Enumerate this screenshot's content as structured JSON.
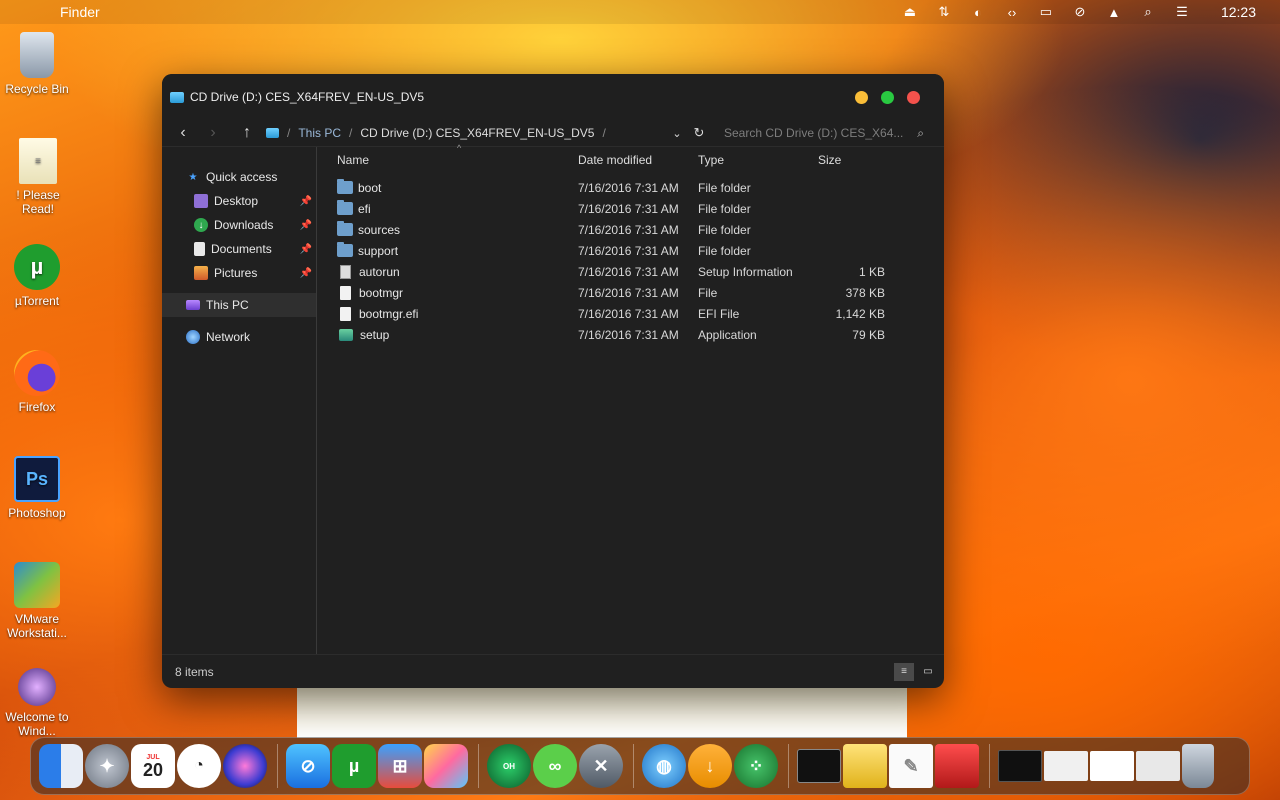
{
  "menubar": {
    "app_name": "Finder",
    "clock": "12:23",
    "status_icons": [
      "eject-icon",
      "switch-icon",
      "night-mode-icon",
      "code-icon",
      "display-icon",
      "mute-icon",
      "eject-up-icon",
      "search-icon",
      "control-center-icon"
    ]
  },
  "desktop": {
    "icons": [
      {
        "label": "Recycle Bin",
        "icon": "recycle-bin-icon"
      },
      {
        "label": "! Please Read!",
        "icon": "notepad-icon"
      },
      {
        "label": "µTorrent",
        "icon": "utorrent-icon"
      },
      {
        "label": "Firefox",
        "icon": "firefox-icon"
      },
      {
        "label": "Photoshop",
        "icon": "photoshop-icon",
        "glyph": "Ps"
      },
      {
        "label": "VMware Workstati...",
        "icon": "vmware-icon"
      },
      {
        "label": "Welcome to Wind...",
        "icon": "welcome-icon"
      }
    ]
  },
  "window": {
    "title": "CD Drive (D:) CES_X64FREV_EN-US_DV5",
    "breadcrumb": [
      "This PC",
      "CD Drive (D:) CES_X64FREV_EN-US_DV5"
    ],
    "search_placeholder": "Search CD Drive (D:) CES_X64...",
    "sidebar": {
      "quick_access": "Quick access",
      "items": [
        {
          "label": "Desktop",
          "pinned": true
        },
        {
          "label": "Downloads",
          "pinned": true
        },
        {
          "label": "Documents",
          "pinned": true
        },
        {
          "label": "Pictures",
          "pinned": true
        }
      ],
      "this_pc": "This PC",
      "network": "Network"
    },
    "columns": {
      "name": "Name",
      "date": "Date modified",
      "type": "Type",
      "size": "Size"
    },
    "files": [
      {
        "name": "boot",
        "date": "7/16/2016 7:31 AM",
        "type": "File folder",
        "size": "",
        "kind": "folder"
      },
      {
        "name": "efi",
        "date": "7/16/2016 7:31 AM",
        "type": "File folder",
        "size": "",
        "kind": "folder"
      },
      {
        "name": "sources",
        "date": "7/16/2016 7:31 AM",
        "type": "File folder",
        "size": "",
        "kind": "folder"
      },
      {
        "name": "support",
        "date": "7/16/2016 7:31 AM",
        "type": "File folder",
        "size": "",
        "kind": "folder"
      },
      {
        "name": "autorun",
        "date": "7/16/2016 7:31 AM",
        "type": "Setup Information",
        "size": "1 KB",
        "kind": "inf"
      },
      {
        "name": "bootmgr",
        "date": "7/16/2016 7:31 AM",
        "type": "File",
        "size": "378 KB",
        "kind": "file"
      },
      {
        "name": "bootmgr.efi",
        "date": "7/16/2016 7:31 AM",
        "type": "EFI File",
        "size": "1,142 KB",
        "kind": "file"
      },
      {
        "name": "setup",
        "date": "7/16/2016 7:31 AM",
        "type": "Application",
        "size": "79 KB",
        "kind": "app"
      }
    ],
    "status": "8 items"
  },
  "dock": {
    "items": [
      "finder-icon",
      "launchpad-icon",
      "calendar-icon",
      "clock-icon",
      "siri-icon",
      "safari-icon",
      "utorrent-icon",
      "windows-icon",
      "photos-icon",
      "ohsoft-icon",
      "link-icon",
      "tools-icon",
      "globe-icon",
      "download-icon",
      "dots-icon",
      "terminal-icon",
      "archive-icon",
      "textedit-icon",
      "toolbox-icon",
      "window-thumb-1",
      "window-thumb-2",
      "window-thumb-3",
      "window-thumb-4",
      "trash-icon"
    ],
    "calendar_day": "20",
    "calendar_month": "JUL"
  }
}
